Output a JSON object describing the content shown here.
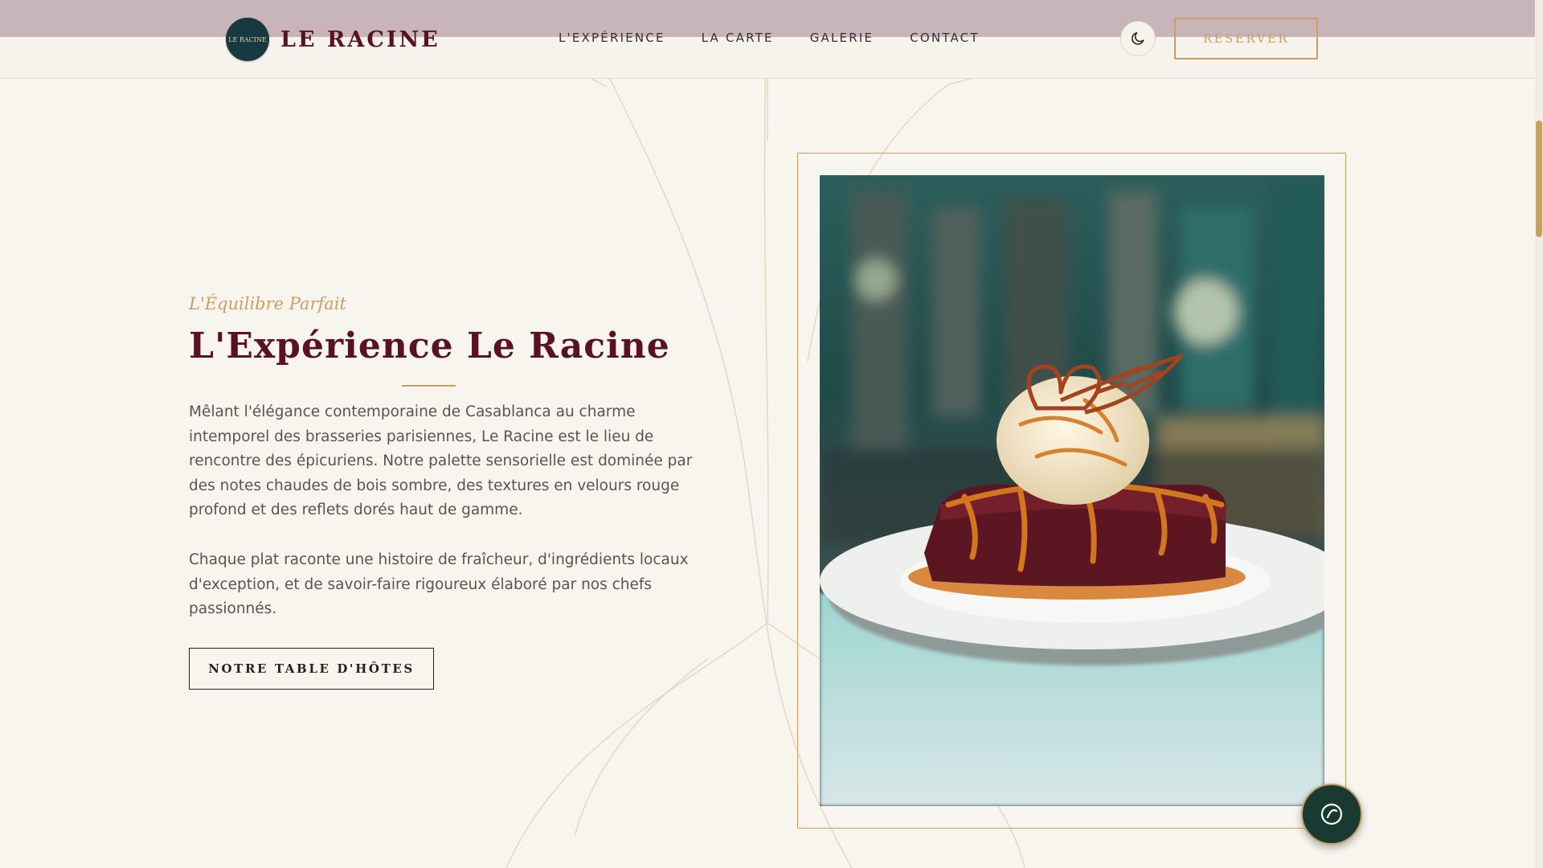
{
  "header": {
    "logo_badge": "LE RACINE",
    "brand": "LE RACINE",
    "nav": [
      "L'EXPÉRIENCE",
      "LA CARTE",
      "GALERIE",
      "CONTACT"
    ],
    "theme_toggle_icon": "moon-icon",
    "reserve_label": "RÉSERVER"
  },
  "section": {
    "eyebrow": "L'Équilibre Parfait",
    "title": "L'Expérience Le Racine",
    "paragraph1": "Mêlant l'élégance contemporaine de Casablanca au charme intemporel des brasseries parisiennes, Le Racine est le lieu de rencontre des épicuriens. Notre palette sensorielle est dominée par des notes chaudes de bois sombre, des textures en velours rouge profond et des reflets dorés haut de gamme.",
    "paragraph2": "Chaque plat raconte une histoire de fraîcheur, d'ingrédients locaux d'exception, et de savoir-faire rigoureux élaboré par nos chefs passionnés.",
    "cta_label": "NOTRE TABLE D'HÔTES"
  },
  "image": {
    "subject": "dessert-photo"
  },
  "chat": {
    "icon": "chat-icon"
  },
  "colors": {
    "burgundy": "#5a1126",
    "gold": "#c9a063",
    "cream": "#f8f5ee",
    "teal": "#17393f"
  }
}
